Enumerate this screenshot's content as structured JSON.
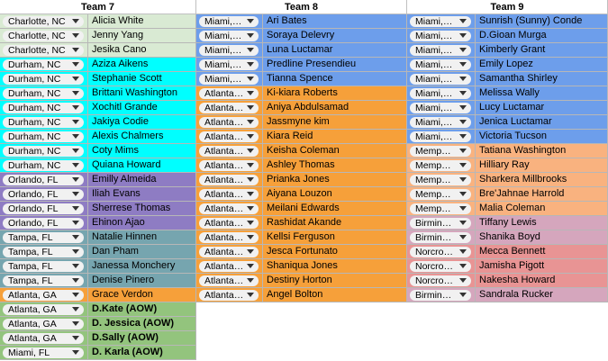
{
  "headers": [
    "Team 7",
    "Team 8",
    "Team 9"
  ],
  "colors": {
    "lightgreen": "#d9ead3",
    "cyan": "#00ffff",
    "purple": "#8e7cc3",
    "teal": "#76a5af",
    "orange": "#f6a03a",
    "green": "#93c47d",
    "blue": "#6d9eeb",
    "salmon": "#f9b27f",
    "pink": "#d5a6bd",
    "rose": "#e89494"
  },
  "team7": [
    {
      "city": "Charlotte, NC",
      "name": "Alicia White",
      "color": "lightgreen"
    },
    {
      "city": "Charlotte, NC",
      "name": "Jenny Yang",
      "color": "lightgreen"
    },
    {
      "city": "Charlotte, NC",
      "name": "Jesika Cano",
      "color": "lightgreen"
    },
    {
      "city": "Durham, NC",
      "name": "Aziza Aikens",
      "color": "cyan"
    },
    {
      "city": "Durham, NC",
      "name": "Stephanie Scott",
      "color": "cyan"
    },
    {
      "city": "Durham, NC",
      "name": "Brittani Washington",
      "color": "cyan"
    },
    {
      "city": "Durham, NC",
      "name": "Xochitl Grande",
      "color": "cyan"
    },
    {
      "city": "Durham, NC",
      "name": "Jakiya Codie",
      "color": "cyan"
    },
    {
      "city": "Durham, NC",
      "name": "Alexis Chalmers",
      "color": "cyan"
    },
    {
      "city": "Durham, NC",
      "name": "Coty Mims",
      "color": "cyan"
    },
    {
      "city": "Durham, NC",
      "name": "Quiana Howard",
      "color": "cyan"
    },
    {
      "city": "Orlando, FL",
      "name": "Emilly Almeida",
      "color": "purple"
    },
    {
      "city": "Orlando, FL",
      "name": "Iliah Evans",
      "color": "purple"
    },
    {
      "city": "Orlando, FL",
      "name": "Sherrese Thomas",
      "color": "purple"
    },
    {
      "city": "Orlando, FL",
      "name": "Ehinon Ajao",
      "color": "purple"
    },
    {
      "city": "Tampa, FL",
      "name": "Natalie Hinnen",
      "color": "teal"
    },
    {
      "city": "Tampa, FL",
      "name": "Dan Pham",
      "color": "teal"
    },
    {
      "city": "Tampa, FL",
      "name": "Janessa Monchery",
      "color": "teal"
    },
    {
      "city": "Tampa, FL",
      "name": "Denise Pinero",
      "color": "teal"
    },
    {
      "city": "Atlanta, GA",
      "name": "Grace Verdon",
      "color": "orange"
    },
    {
      "city": "Atlanta, GA",
      "name": "D.Kate (AOW)",
      "color": "green",
      "bold": true
    },
    {
      "city": "Atlanta, GA",
      "name": "D. Jessica (AOW)",
      "color": "green",
      "bold": true
    },
    {
      "city": "Atlanta, GA",
      "name": "D.Sally (AOW)",
      "color": "green",
      "bold": true
    },
    {
      "city": "Miami, FL",
      "name": "D. Karla (AOW)",
      "color": "green",
      "bold": true
    }
  ],
  "team8": [
    {
      "city": "Miami,…",
      "name": "Ari Bates",
      "color": "blue"
    },
    {
      "city": "Miami,…",
      "name": "Soraya Delevry",
      "color": "blue"
    },
    {
      "city": "Miami,…",
      "name": "Luna Luctamar",
      "color": "blue"
    },
    {
      "city": "Miami,…",
      "name": "Predline Presendieu",
      "color": "blue"
    },
    {
      "city": "Miami,…",
      "name": "Tianna Spence",
      "color": "blue"
    },
    {
      "city": "Atlanta…",
      "name": " Ki-kiara Roberts",
      "color": "orange"
    },
    {
      "city": "Atlanta…",
      "name": "Aniya Abdulsamad",
      "color": "orange"
    },
    {
      "city": "Atlanta…",
      "name": "Jassmyne kim",
      "color": "orange"
    },
    {
      "city": "Atlanta…",
      "name": "Kiara Reid",
      "color": "orange"
    },
    {
      "city": "Atlanta…",
      "name": "Keisha Coleman",
      "color": "orange"
    },
    {
      "city": "Atlanta…",
      "name": " Ashley Thomas",
      "color": "orange"
    },
    {
      "city": "Atlanta…",
      "name": "Prianka Jones",
      "color": "orange"
    },
    {
      "city": "Atlanta…",
      "name": "Aiyana Louzon",
      "color": "orange"
    },
    {
      "city": "Atlanta…",
      "name": "Meilani Edwards",
      "color": "orange"
    },
    {
      "city": "Atlanta…",
      "name": " Rashidat Akande",
      "color": "orange"
    },
    {
      "city": "Atlanta…",
      "name": "Kellsi Ferguson",
      "color": "orange"
    },
    {
      "city": "Atlanta…",
      "name": "Jesca Fortunato",
      "color": "orange"
    },
    {
      "city": "Atlanta…",
      "name": " Shaniqua Jones",
      "color": "orange"
    },
    {
      "city": "Atlanta…",
      "name": "Destiny Horton",
      "color": "orange"
    },
    {
      "city": "Atlanta…",
      "name": "Angel Bolton",
      "color": "orange"
    }
  ],
  "team9": [
    {
      "city": "Miami,…",
      "name": "Sunrish (Sunny) Conde",
      "color": "blue"
    },
    {
      "city": "Miami,…",
      "name": "D.Gioan Murga",
      "color": "blue"
    },
    {
      "city": "Miami,…",
      "name": "Kimberly Grant",
      "color": "blue"
    },
    {
      "city": "Miami,…",
      "name": "Emily Lopez",
      "color": "blue"
    },
    {
      "city": "Miami,…",
      "name": "Samantha Shirley",
      "color": "blue"
    },
    {
      "city": "Miami,…",
      "name": "Melissa Wally",
      "color": "blue"
    },
    {
      "city": "Miami,…",
      "name": "Lucy Luctamar",
      "color": "blue"
    },
    {
      "city": "Miami,…",
      "name": "Jenica Luctamar",
      "color": "blue"
    },
    {
      "city": "Miami,…",
      "name": "Victoria Tucson",
      "color": "blue"
    },
    {
      "city": "Memp…",
      "name": "Tatiana Washington",
      "color": "salmon"
    },
    {
      "city": "Memp…",
      "name": "Hilliary Ray",
      "color": "salmon"
    },
    {
      "city": "Memp…",
      "name": "Sharkera Millbrooks",
      "color": "salmon"
    },
    {
      "city": "Memp…",
      "name": "Bre'Jahnae Harrold",
      "color": "salmon"
    },
    {
      "city": "Memp…",
      "name": "Malia Coleman",
      "color": "salmon"
    },
    {
      "city": "Birmin…",
      "name": "Tiffany Lewis",
      "color": "pink"
    },
    {
      "city": "Birmin…",
      "name": "Shanika Boyd",
      "color": "pink"
    },
    {
      "city": "Norcro…",
      "name": "Mecca Bennett",
      "color": "rose"
    },
    {
      "city": "Norcro…",
      "name": "Jamisha Pigott",
      "color": "rose"
    },
    {
      "city": "Norcro…",
      "name": "Nakesha Howard",
      "color": "rose"
    },
    {
      "city": "Birmin…",
      "name": "Sandrala Rucker",
      "color": "pink"
    }
  ]
}
